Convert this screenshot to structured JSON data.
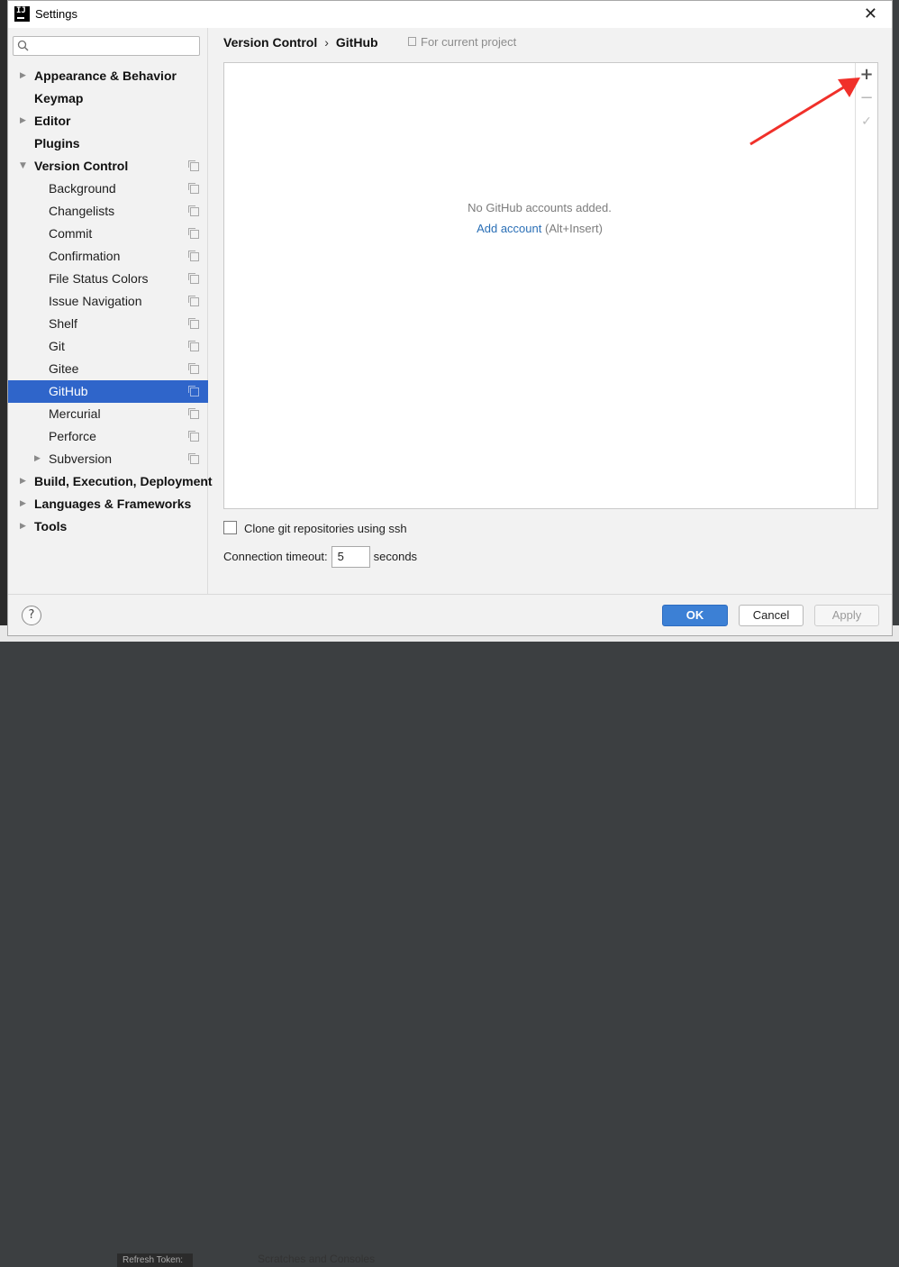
{
  "window": {
    "title": "Settings"
  },
  "sidebar": {
    "search": {
      "value": "",
      "placeholder": ""
    },
    "items": [
      {
        "label": "Appearance & Behavior",
        "level": 0,
        "expandable": true,
        "expanded": false
      },
      {
        "label": "Keymap",
        "level": 0,
        "expandable": false
      },
      {
        "label": "Editor",
        "level": 0,
        "expandable": true,
        "expanded": false
      },
      {
        "label": "Plugins",
        "level": 0,
        "expandable": false
      },
      {
        "label": "Version Control",
        "level": 0,
        "expandable": true,
        "expanded": true
      },
      {
        "label": "Background",
        "level": 1
      },
      {
        "label": "Changelists",
        "level": 1
      },
      {
        "label": "Commit",
        "level": 1
      },
      {
        "label": "Confirmation",
        "level": 1
      },
      {
        "label": "File Status Colors",
        "level": 1
      },
      {
        "label": "Issue Navigation",
        "level": 1
      },
      {
        "label": "Shelf",
        "level": 1
      },
      {
        "label": "Git",
        "level": 1
      },
      {
        "label": "Gitee",
        "level": 1
      },
      {
        "label": "GitHub",
        "level": 1,
        "selected": true
      },
      {
        "label": "Mercurial",
        "level": 1
      },
      {
        "label": "Perforce",
        "level": 1
      },
      {
        "label": "Subversion",
        "level": 1,
        "expandable": true,
        "expanded": false
      },
      {
        "label": "Build, Execution, Deployment",
        "level": 0,
        "expandable": true,
        "expanded": false
      },
      {
        "label": "Languages & Frameworks",
        "level": 0,
        "expandable": true,
        "expanded": false
      },
      {
        "label": "Tools",
        "level": 0,
        "expandable": true,
        "expanded": false
      }
    ]
  },
  "breadcrumb": {
    "parent": "Version Control",
    "separator": "›",
    "current": "GitHub",
    "scope": "For current project"
  },
  "accounts": {
    "empty_message": "No GitHub accounts added.",
    "add_link": "Add account",
    "add_shortcut": "(Alt+Insert)",
    "toolbar": {
      "add_icon": "+",
      "remove_icon": "−",
      "default_icon": "✓"
    }
  },
  "options": {
    "clone_ssh_label": "Clone git repositories using ssh",
    "clone_ssh_checked": false,
    "timeout_label": "Connection timeout:",
    "timeout_value": "5",
    "timeout_unit": "seconds"
  },
  "footer": {
    "help": "?",
    "ok": "OK",
    "cancel": "Cancel",
    "apply": "Apply"
  },
  "background": {
    "bottom_text": "Scratches and Consoles",
    "bottom_dark_text": "Refresh Token:"
  },
  "colors": {
    "selection": "#2f65ca",
    "link": "#2a6fb6",
    "ok_button": "#3c80d5",
    "annotation_arrow": "#f0302a"
  }
}
